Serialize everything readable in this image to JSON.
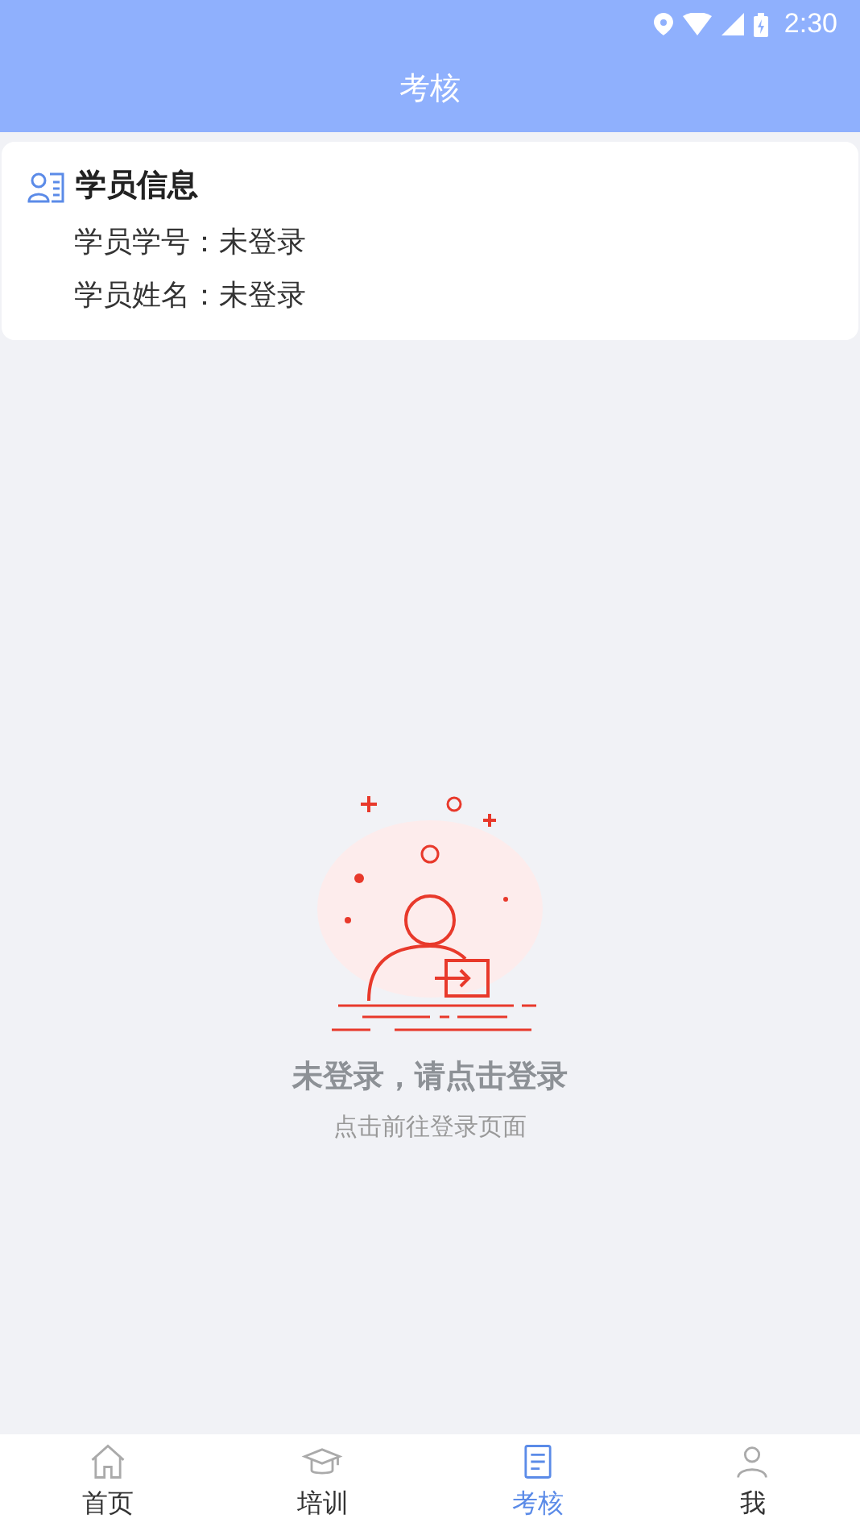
{
  "status_bar": {
    "time": "2:30"
  },
  "header": {
    "title": "考核"
  },
  "student_card": {
    "title": "学员信息",
    "fields": [
      {
        "label": "学员学号：",
        "value": "未登录"
      },
      {
        "label": "学员姓名：",
        "value": "未登录"
      }
    ]
  },
  "empty_state": {
    "title": "未登录，请点击登录",
    "subtitle": "点击前往登录页面"
  },
  "bottom_nav": [
    {
      "kind": "home",
      "label": "首页",
      "selected": false
    },
    {
      "kind": "training",
      "label": "培训",
      "selected": false
    },
    {
      "kind": "exam",
      "label": "考核",
      "selected": true
    },
    {
      "kind": "me",
      "label": "我",
      "selected": false
    }
  ]
}
